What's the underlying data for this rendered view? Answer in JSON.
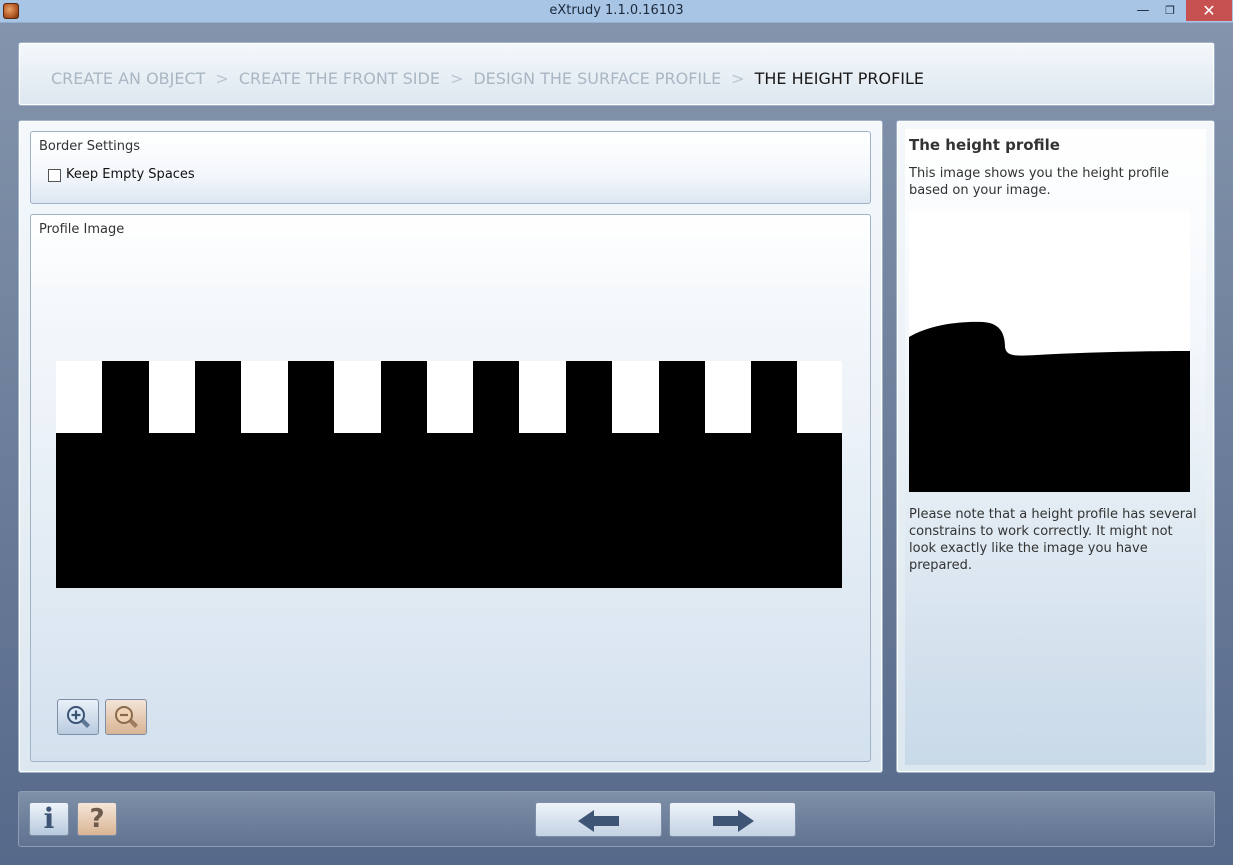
{
  "window": {
    "title": "eXtrudy 1.1.0.16103",
    "minimize_glyph": "—",
    "maximize_glyph": "❐",
    "close_glyph": "✕"
  },
  "breadcrumb": {
    "separator": ">",
    "steps": [
      "CREATE AN OBJECT",
      "CREATE THE FRONT SIDE",
      "DESIGN THE SURFACE PROFILE",
      "THE HEIGHT PROFILE"
    ],
    "active_index": 3
  },
  "border_settings": {
    "title": "Border Settings",
    "keep_empty_spaces_label": "Keep Empty Spaces",
    "keep_empty_spaces_checked": false
  },
  "profile_image": {
    "title": "Profile Image"
  },
  "info": {
    "title": "The height profile",
    "text": "This image shows you the height profile based on your image.",
    "note": "Please note that a height profile has several constrains to work correctly. It might not look exactly like the image you have prepared."
  },
  "icons": {
    "zoom_in": "zoom-in-icon",
    "zoom_out": "zoom-out-icon",
    "info": "i",
    "help": "?",
    "back": "arrow-left-icon",
    "next": "arrow-right-icon"
  },
  "colors": {
    "titlebar": "#a9c5e6",
    "close_button": "#c75050",
    "breadcrumb_inactive": "#a9b6c3",
    "breadcrumb_active": "#1a1a1a"
  }
}
